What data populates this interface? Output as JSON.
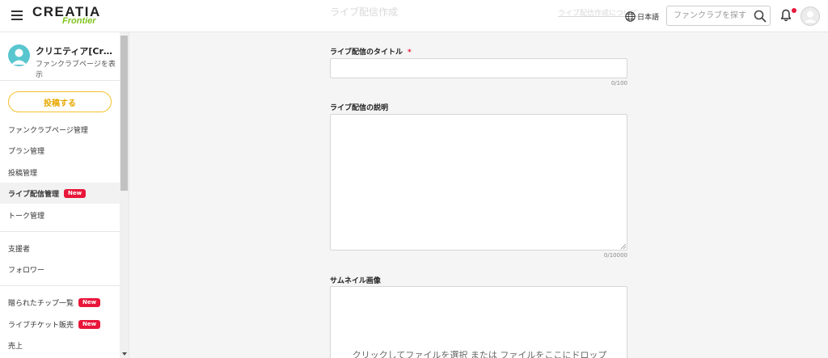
{
  "header": {
    "logo_main": "CREATIA",
    "logo_sub": "Frontier",
    "page_heading_ghost": "ライブ配信作成",
    "ghost_link": "ライブ配信作成について",
    "language_label": "日本語",
    "search_placeholder": "ファンクラブを探す"
  },
  "sidebar": {
    "profile_name": "クリエティア[Creati...",
    "profile_link": "ファンクラブページを表示",
    "post_button": "投稿する",
    "items": [
      {
        "label": "ファンクラブページ管理"
      },
      {
        "label": "プラン管理"
      },
      {
        "label": "投稿管理"
      },
      {
        "label": "ライブ配信管理",
        "badge": "New"
      },
      {
        "label": "トーク管理"
      },
      {
        "label": "支援者"
      },
      {
        "label": "フォロワー"
      },
      {
        "label": "贈られたチップ一覧",
        "badge": "New"
      },
      {
        "label": "ライブチケット販売",
        "badge": "New"
      },
      {
        "label": "売上"
      }
    ]
  },
  "form": {
    "title_label": "ライブ配信のタイトル",
    "required_mark": "*",
    "title_counter": "0/100",
    "description_label": "ライブ配信の説明",
    "description_counter": "0/10000",
    "thumbnail_label": "サムネイル画像",
    "dropzone_text": "クリックしてファイルを選択 または ファイルをここにドロップ"
  },
  "colors": {
    "accent_yellow": "#f5c12e",
    "new_badge": "#e8173a",
    "logo_green": "#7fc31c",
    "profile_avatar": "#59c6cf"
  }
}
